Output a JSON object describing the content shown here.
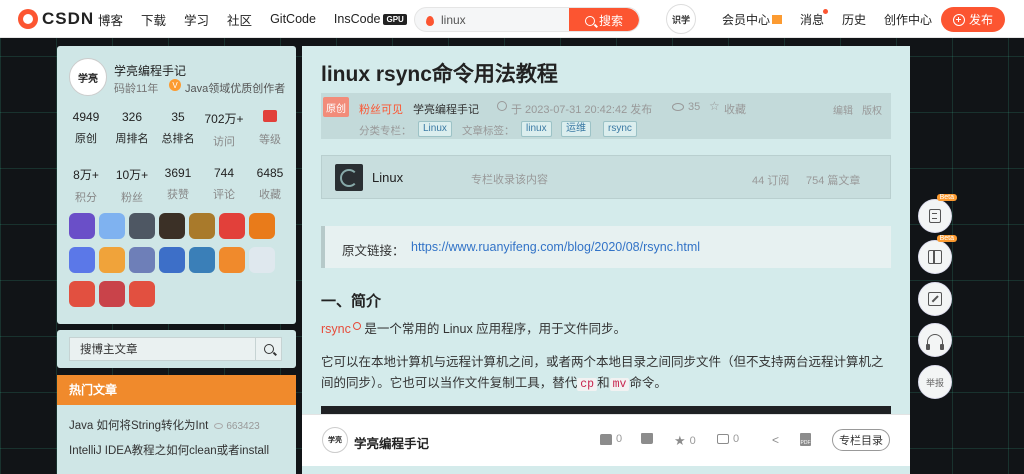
{
  "header": {
    "logo_text": "CSDN",
    "nav": [
      "博客",
      "下载",
      "学习",
      "社区",
      "GitCode",
      "InsCode"
    ],
    "gpu_badge": "GPU",
    "search_value": "linux",
    "search_button": "搜索",
    "avatar_text": "识学",
    "right_nav": [
      "会员中心",
      "消息",
      "历史",
      "创作中心"
    ],
    "publish": "发布"
  },
  "profile": {
    "avatar_text": "学亮",
    "name": "学亮编程手记",
    "age": "码龄11年",
    "v_mark": "V",
    "title": "Java领域优质创作者",
    "stats_row1": [
      {
        "value": "4949",
        "label": "原创"
      },
      {
        "value": "326",
        "label": "周排名"
      },
      {
        "value": "35",
        "label": "总排名"
      },
      {
        "value": "702万+",
        "label": "访问"
      },
      {
        "value": "",
        "label": "等级"
      }
    ],
    "stats_row2": [
      {
        "value": "8万+",
        "label": "积分"
      },
      {
        "value": "10万+",
        "label": "粉丝"
      },
      {
        "value": "3691",
        "label": "获赞"
      },
      {
        "value": "744",
        "label": "评论"
      },
      {
        "value": "6485",
        "label": "收藏"
      }
    ],
    "badges": [
      {
        "color": "#6a4fc8"
      },
      {
        "color": "#7fb2f0"
      },
      {
        "color": "#4e5763"
      },
      {
        "color": "#3b3026"
      },
      {
        "color": "#a97a2b"
      },
      {
        "color": "#e2403a"
      },
      {
        "color": "#e97b1a"
      },
      {
        "color": "#5b78e8"
      },
      {
        "color": "#f0a33a"
      },
      {
        "color": "#6e7fb8"
      },
      {
        "color": "#3d6fc8"
      },
      {
        "color": "#3a7fb8"
      },
      {
        "color": "#f08a2c"
      },
      {
        "color": "#dfe8ee"
      },
      {
        "color": "#e25040"
      },
      {
        "color": "#c9434a"
      },
      {
        "color": "#e25040"
      }
    ]
  },
  "side_search": {
    "placeholder": "搜博主文章"
  },
  "hot": {
    "title": "热门文章",
    "items": [
      {
        "title": "Java 如何将String转化为Int",
        "count": "663423"
      },
      {
        "title": "IntelliJ IDEA教程之如何clean或者install",
        "count": ""
      }
    ]
  },
  "article": {
    "title": "linux rsync命令用法教程",
    "original": "原创",
    "fans_only": "粉丝可见",
    "author": "学亮编程手记",
    "date": "于 2023-07-31 20:42:42 发布",
    "views": "35",
    "favorite": "收藏",
    "edit": "编辑",
    "copyright": "版权",
    "category_label": "分类专栏：",
    "category": "Linux",
    "tags_label": "文章标签：",
    "tags": [
      "linux",
      "运维",
      "rsync"
    ],
    "column": {
      "name": "Linux",
      "desc": "专栏收录该内容",
      "subs": "44 订阅",
      "articles": "754 篇文章"
    },
    "quote_label": "原文链接：",
    "quote_link": "https://www.ruanyifeng.com/blog/2020/08/rsync.html",
    "section1": "一、简介",
    "p1_kw": "rsync",
    "p1_rest": " 是一个常用的 Linux 应用程序，用于文件同步。",
    "p2_a": "它可以在本地计算机与远程计算机之间，或者两个本地目录之间同步文件（但不支持两台远程计算机之间的同步）。它也可以当作文件复制工具，替代",
    "p2_cp": "cp",
    "p2_and": "和",
    "p2_mv": "mv",
    "p2_end": "命令。"
  },
  "bottom_bar": {
    "avatar_text": "学亮",
    "name": "学亮编程手记",
    "likes": "0",
    "dislikes": "",
    "favorites": "0",
    "comments": "0",
    "pdf": "PDF",
    "column_dir": "专栏目录"
  },
  "float_tools": {
    "beta": "Beta",
    "report": "举报"
  },
  "colors": {
    "brand": "#fc5531",
    "hot_header": "#f08a2c",
    "card_bg": "#cfe6e6"
  }
}
